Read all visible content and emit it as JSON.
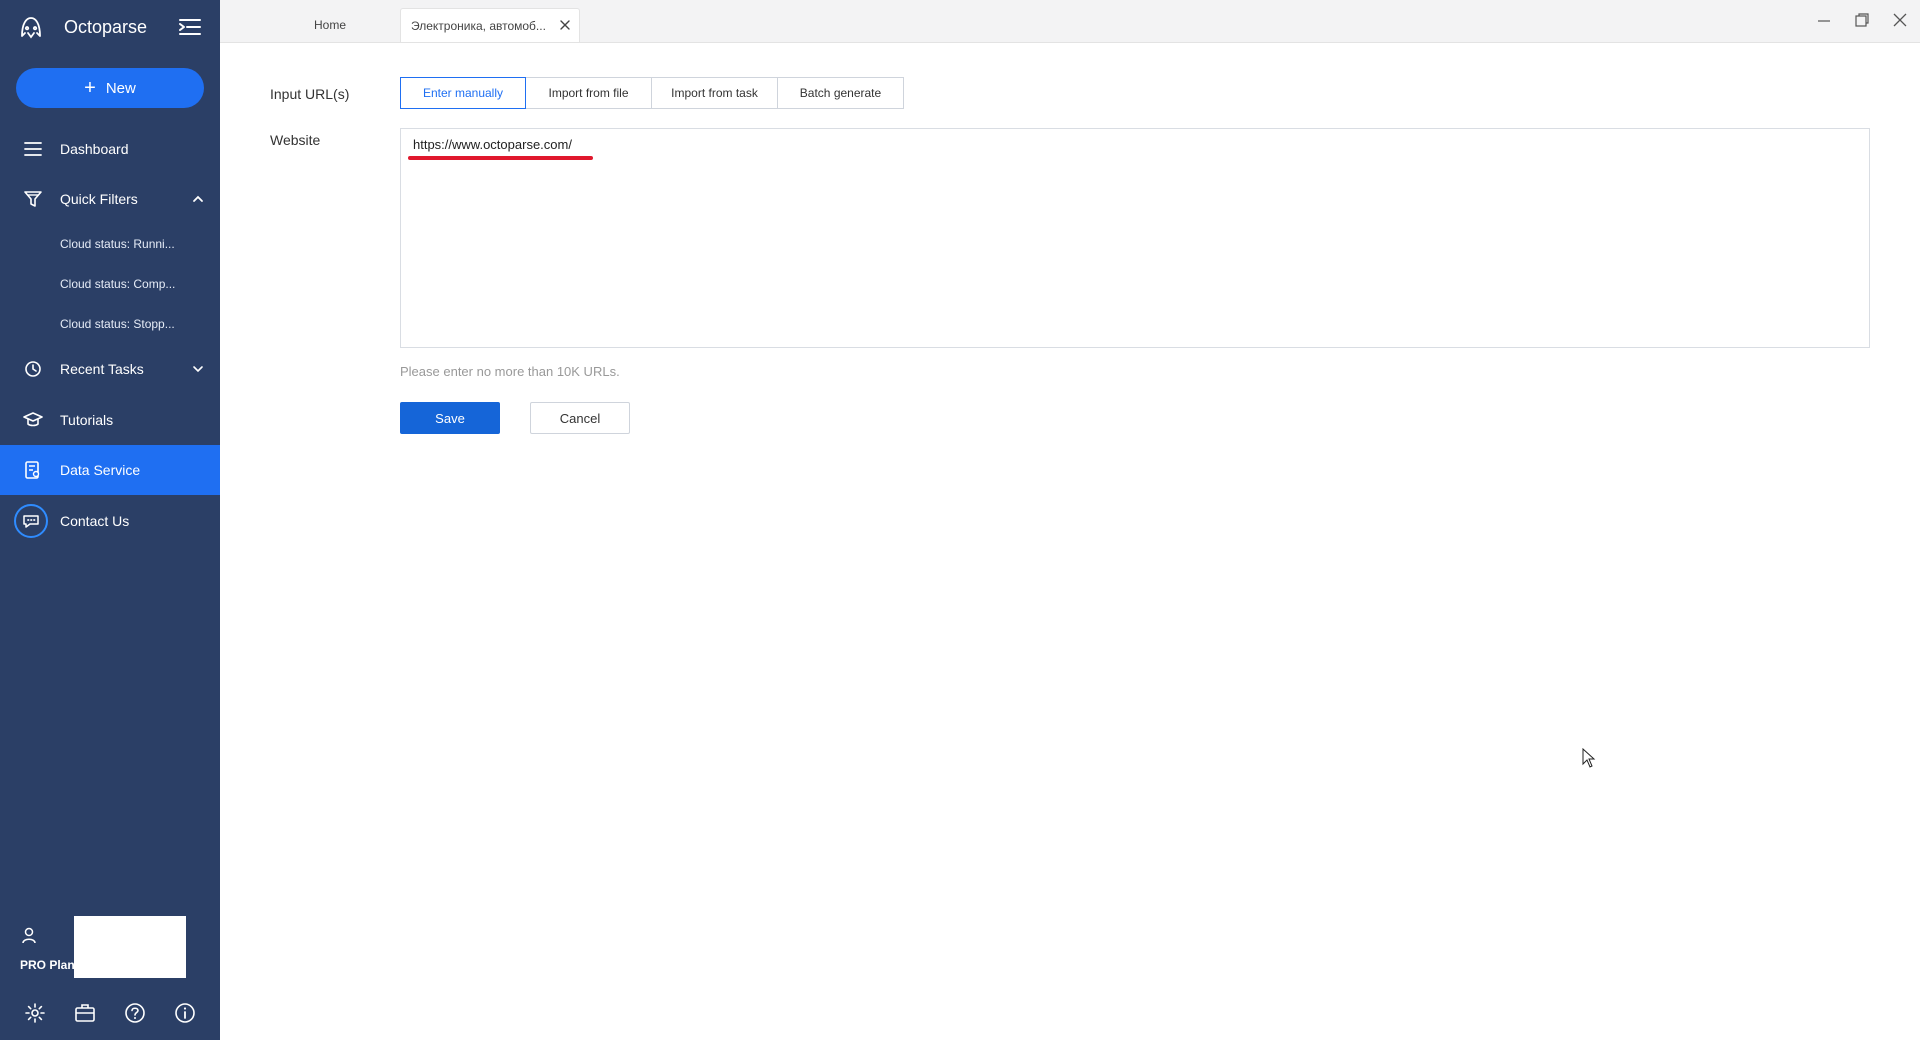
{
  "app": {
    "name": "Octoparse"
  },
  "sidebar": {
    "new_label": "New",
    "items": {
      "dashboard": "Dashboard",
      "quick_filters": "Quick Filters",
      "recent_tasks": "Recent Tasks",
      "tutorials": "Tutorials",
      "data_service": "Data Service",
      "contact_us": "Contact Us"
    },
    "quick_filters": [
      "Cloud status: Runni...",
      "Cloud status: Comp...",
      "Cloud status: Stopp..."
    ],
    "plan_label": "PRO Plan"
  },
  "tabs": {
    "home": "Home",
    "active": "Электроника, автомоб..."
  },
  "form": {
    "input_urls_label": "Input URL(s)",
    "modes": [
      "Enter manually",
      "Import from file",
      "Import from task",
      "Batch generate"
    ],
    "active_mode": "Enter manually",
    "website_label": "Website",
    "url_value": "https://www.octoparse.com/",
    "hint": "Please enter no more than 10K URLs.",
    "save_label": "Save",
    "cancel_label": "Cancel"
  },
  "colors": {
    "sidebar_bg": "#2b3f66",
    "accent": "#1f6ff2",
    "underline": "#e0182d"
  }
}
